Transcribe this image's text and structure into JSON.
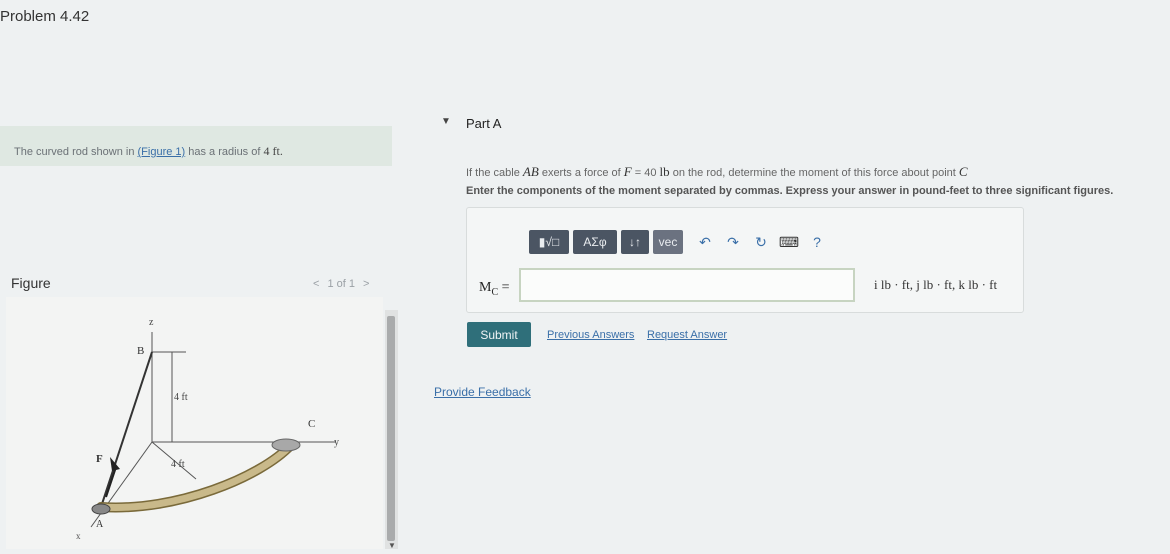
{
  "header": {
    "title": "Problem 4.42"
  },
  "intro": {
    "text_before": "The curved rod shown in ",
    "figure_link": "(Figure 1)",
    "text_after": " has a radius of ",
    "radius": "4 ft."
  },
  "figure_panel": {
    "label": "Figure",
    "pager": {
      "prev": "<",
      "text": "1 of 1",
      "next": ">"
    },
    "diagram": {
      "labels": {
        "z": "z",
        "B": "B",
        "C": "C",
        "y": "y",
        "F": "F",
        "A": "A",
        "x": "x",
        "dim1": "4 ft",
        "dim2": "4 ft"
      }
    }
  },
  "part": {
    "label": "Part A",
    "question": {
      "t1": "If the cable ",
      "cable": "AB",
      "t2": " exerts a force of ",
      "f_sym": "F",
      "t3": " = 40 ",
      "unit": "lb",
      "t4": " on the rod, determine the moment of this force about point ",
      "point": "C"
    },
    "instructions": "Enter the components of the moment separated by commas. Express your answer in pound-feet to three significant figures.",
    "toolbar": {
      "templates": "▮√□",
      "greek": "ΑΣφ",
      "arrows": "↓↑",
      "vec": "vec",
      "undo": "↶",
      "redo": "↷",
      "reset": "↻",
      "keyboard": "⌨",
      "help": "?"
    },
    "answer": {
      "label": "M",
      "label_sub": "C",
      "equals": " =",
      "value": "",
      "placeholder": ""
    },
    "units": "i lb · ft, j lb · ft, k lb · ft",
    "submit": "Submit",
    "previous_answers": "Previous Answers",
    "request_answer": "Request Answer"
  },
  "feedback": "Provide Feedback",
  "colors": {
    "submit_bg": "#2f6f7a",
    "link": "#3a6fa8",
    "rod": "#c9b98a"
  }
}
